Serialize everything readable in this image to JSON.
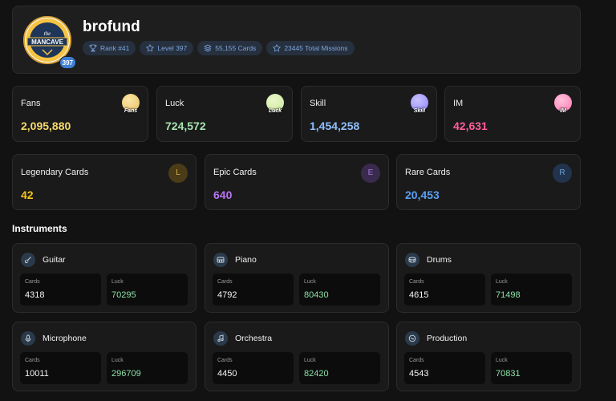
{
  "profile": {
    "username": "brofund",
    "avatar_level_badge": "397",
    "avatar_logo": {
      "top": "the",
      "main": "MANCAVE"
    },
    "chips": [
      {
        "icon": "trophy-icon",
        "label": "Rank #41"
      },
      {
        "icon": "star-icon",
        "label": "Level 397"
      },
      {
        "icon": "layers-icon",
        "label": "55,155 Cards"
      },
      {
        "icon": "star-icon",
        "label": "23445 Total Missions"
      }
    ]
  },
  "stats": [
    {
      "label": "Fans",
      "value": "2,095,880",
      "badge_text": "Fans",
      "value_color": "#f6d96a",
      "badge_color": "#e6c068"
    },
    {
      "label": "Luck",
      "value": "724,572",
      "badge_text": "Luck",
      "value_color": "#a7e3b0",
      "badge_color": "#cbe8a0"
    },
    {
      "label": "Skill",
      "value": "1,454,258",
      "badge_text": "Skill",
      "value_color": "#8fbfff",
      "badge_color": "#8f84ff"
    },
    {
      "label": "IM",
      "value": "42,631",
      "badge_text": "IM",
      "value_color": "#ff5d9c",
      "badge_color": "#ff78b0"
    }
  ],
  "rarities": [
    {
      "label": "Legendary Cards",
      "value": "42",
      "letter": "L",
      "value_color": "#f5c518",
      "letter_bg": "#4a3c16",
      "letter_color": "#d8b04a"
    },
    {
      "label": "Epic Cards",
      "value": "640",
      "letter": "E",
      "value_color": "#b774f0",
      "letter_bg": "#3a2a4e",
      "letter_color": "#a87ad6"
    },
    {
      "label": "Rare Cards",
      "value": "20,453",
      "letter": "R",
      "value_color": "#5aa0f2",
      "letter_bg": "#22344d",
      "letter_color": "#6f9fd8"
    }
  ],
  "instruments_title": "Instruments",
  "cards_label": "Cards",
  "luck_label": "Luck",
  "instruments": [
    {
      "name": "Guitar",
      "icon": "guitar-icon",
      "cards": "4318",
      "luck": "70295"
    },
    {
      "name": "Piano",
      "icon": "piano-icon",
      "cards": "4792",
      "luck": "80430"
    },
    {
      "name": "Drums",
      "icon": "drum-icon",
      "cards": "4615",
      "luck": "71498"
    },
    {
      "name": "Microphone",
      "icon": "microphone-icon",
      "cards": "10011",
      "luck": "296709"
    },
    {
      "name": "Orchestra",
      "icon": "music-note-icon",
      "cards": "4450",
      "luck": "82420"
    },
    {
      "name": "Production",
      "icon": "disc-icon",
      "cards": "4543",
      "luck": "70831"
    }
  ]
}
